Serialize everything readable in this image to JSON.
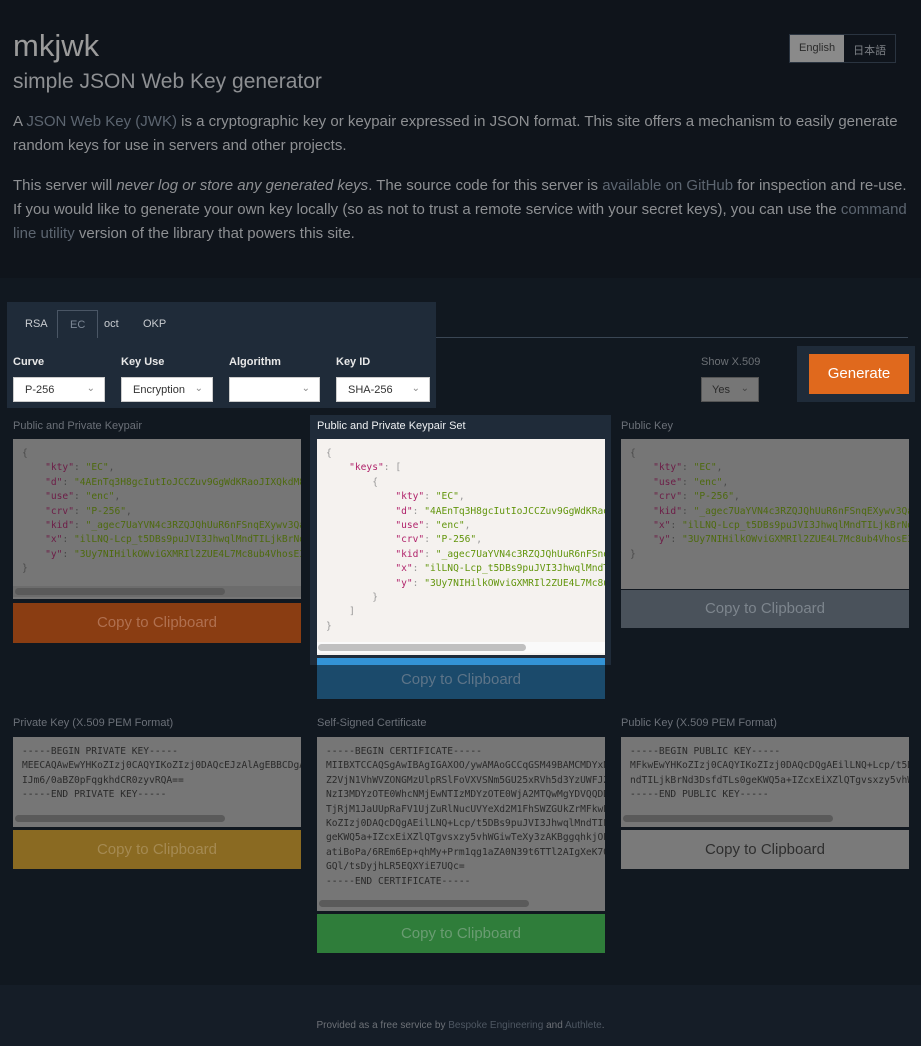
{
  "header": {
    "title": "mkjwk",
    "subtitle": "simple JSON Web Key generator",
    "lang": [
      "English",
      "日本語"
    ],
    "p1": {
      "pre": "A ",
      "link": "JSON Web Key (JWK)",
      "post": " is a cryptographic key or keypair expressed in JSON format. This site offers a mechanism to easily generate random keys for use in servers and other projects."
    },
    "p2": {
      "a": "This server will ",
      "em": "never log or store any generated keys",
      "b": ". The source code for this server is ",
      "link1": "available on GitHub",
      "c": " for inspection and re-use. If you would like to generate your own key locally (so as not to trust a remote service with your secret keys), you can use the ",
      "link2": "command line utility",
      "d": " version of the library that powers this site."
    }
  },
  "tabs": [
    "RSA",
    "EC",
    "oct",
    "OKP"
  ],
  "active_tab": "EC",
  "fields": [
    {
      "label": "Curve",
      "value": "P-256"
    },
    {
      "label": "Key Use",
      "value": "Encryption"
    },
    {
      "label": "Algorithm",
      "value": ""
    },
    {
      "label": "Key ID",
      "value": "SHA-256"
    }
  ],
  "x509": {
    "label": "Show X.509",
    "value": "Yes"
  },
  "generate": "Generate",
  "copy": "Copy to Clipboard",
  "panels": {
    "keypair": {
      "label": "Public and Private Keypair",
      "lines": [
        "{",
        "    \"kty\": \"EC\",",
        "    \"d\": \"4AEnTq3H8gcIutIoJCCZuv9GgWdKRaoJIXQkdM8r",
        "    \"use\": \"enc\",",
        "    \"crv\": \"P-256\",",
        "    \"kid\": \"_agec7UaYVN4c3RZQJQhUuR6nFSnqEXywv3QaI",
        "    \"x\": \"ilLNQ-Lcp_t5DBs9puJVI3JhwqlMndTILjkBrNd3",
        "    \"y\": \"3Uy7NIHilkOWviGXMRIl2ZUE4L7Mc8ub4VhosE3l",
        "}"
      ]
    },
    "set": {
      "label": "Public and Private Keypair Set",
      "lines": [
        "{",
        "    \"keys\": [",
        "        {",
        "            \"kty\": \"EC\",",
        "            \"d\": \"4AEnTq3H8gcIutIoJCCZuv9GgWdKRaoJ",
        "            \"use\": \"enc\",",
        "            \"crv\": \"P-256\",",
        "            \"kid\": \"_agec7UaYVN4c3RZQJQhUuR6nFSnqE",
        "            \"x\": \"ilLNQ-Lcp_t5DBs9puJVI3JhwqlMndTI",
        "            \"y\": \"3Uy7NIHilkOWviGXMRIl2ZUE4L7Mc8ub",
        "        }",
        "    ]",
        "}"
      ]
    },
    "public": {
      "label": "Public Key",
      "lines": [
        "{",
        "    \"kty\": \"EC\",",
        "    \"use\": \"enc\",",
        "    \"crv\": \"P-256\",",
        "    \"kid\": \"_agec7UaYVN4c3RZQJQhUuR6nFSnqEXywv3QaI",
        "    \"x\": \"ilLNQ-Lcp_t5DBs9puJVI3JhwqlMndTILjkBrNd3",
        "    \"y\": \"3Uy7NIHilkOWviGXMRIl2ZUE4L7Mc8ub4VhosE3l",
        "}"
      ]
    },
    "privpem": {
      "label": "Private Key (X.509 PEM Format)",
      "text": "-----BEGIN PRIVATE KEY-----\nMEECAQAwEwYHKoZIzj0CAQYIKoZIzj0DAQcEJzAlAgEBBCDgAS\nIJm6/0aBZ0pFqgkhdCR0zyvRQA==\n-----END PRIVATE KEY-----"
    },
    "cert": {
      "label": "Self-Signed Certificate",
      "text": "-----BEGIN CERTIFICATE-----\nMIIBXTCCAQSgAwIBAgIGAXOO/ywAMAoGCCqGSM49BAMCMDYxND\nZ2VjN1VhWVZONGMzUlpRSlFoVXVSNm5GU25xRVh5d3YzUWFJZk\nNzI3MDYzOTE0WhcNMjEwNTIzMDYzOTE0WjA2MTQwMgYDVQQDDC\nTjRjM1JaUUpRaFV1UjZuRlNucUVYeXd2M1FhSWZGUkZrMFkwEw\nKoZIzj0DAQcDQgAEilLNQ+Lcp/t5DBs9puJVI3JhwqlMndTILj\ngeKWQ5a+IZcxEiXZlQTgvsxzy5vhWGiwTeXy3zAKBggqhkjOPQ\natiBoPa/6REm6Ep+qhMy+Prm1qg1aZA0N39t6TTl2AIgXeK7Ow\nGQl/tsDyjhLR5EQXYiE7UQc=\n-----END CERTIFICATE-----"
    },
    "pubpem": {
      "label": "Public Key (X.509 PEM Format)",
      "text": "-----BEGIN PUBLIC KEY-----\nMFkwEwYHKoZIzj0CAQYIKoZIzj0DAQcDQgAEilLNQ+Lcp/t5DB\nndTILjkBrNd3DsfdTLs0geKWQ5a+IZcxEiXZlQTgvsxzy5vhWG\n-----END PUBLIC KEY-----"
    }
  },
  "footer": {
    "a": "Provided as a free service by ",
    "l1": "Bespoke Engineering",
    "b": " and ",
    "l2": "Authlete",
    "c": "."
  },
  "colors": {
    "accent_orange": "#e0691d",
    "copy_blue": "#1b4a6b",
    "copy_green": "#2f7d3a",
    "copy_yellow": "#8a6a22"
  }
}
